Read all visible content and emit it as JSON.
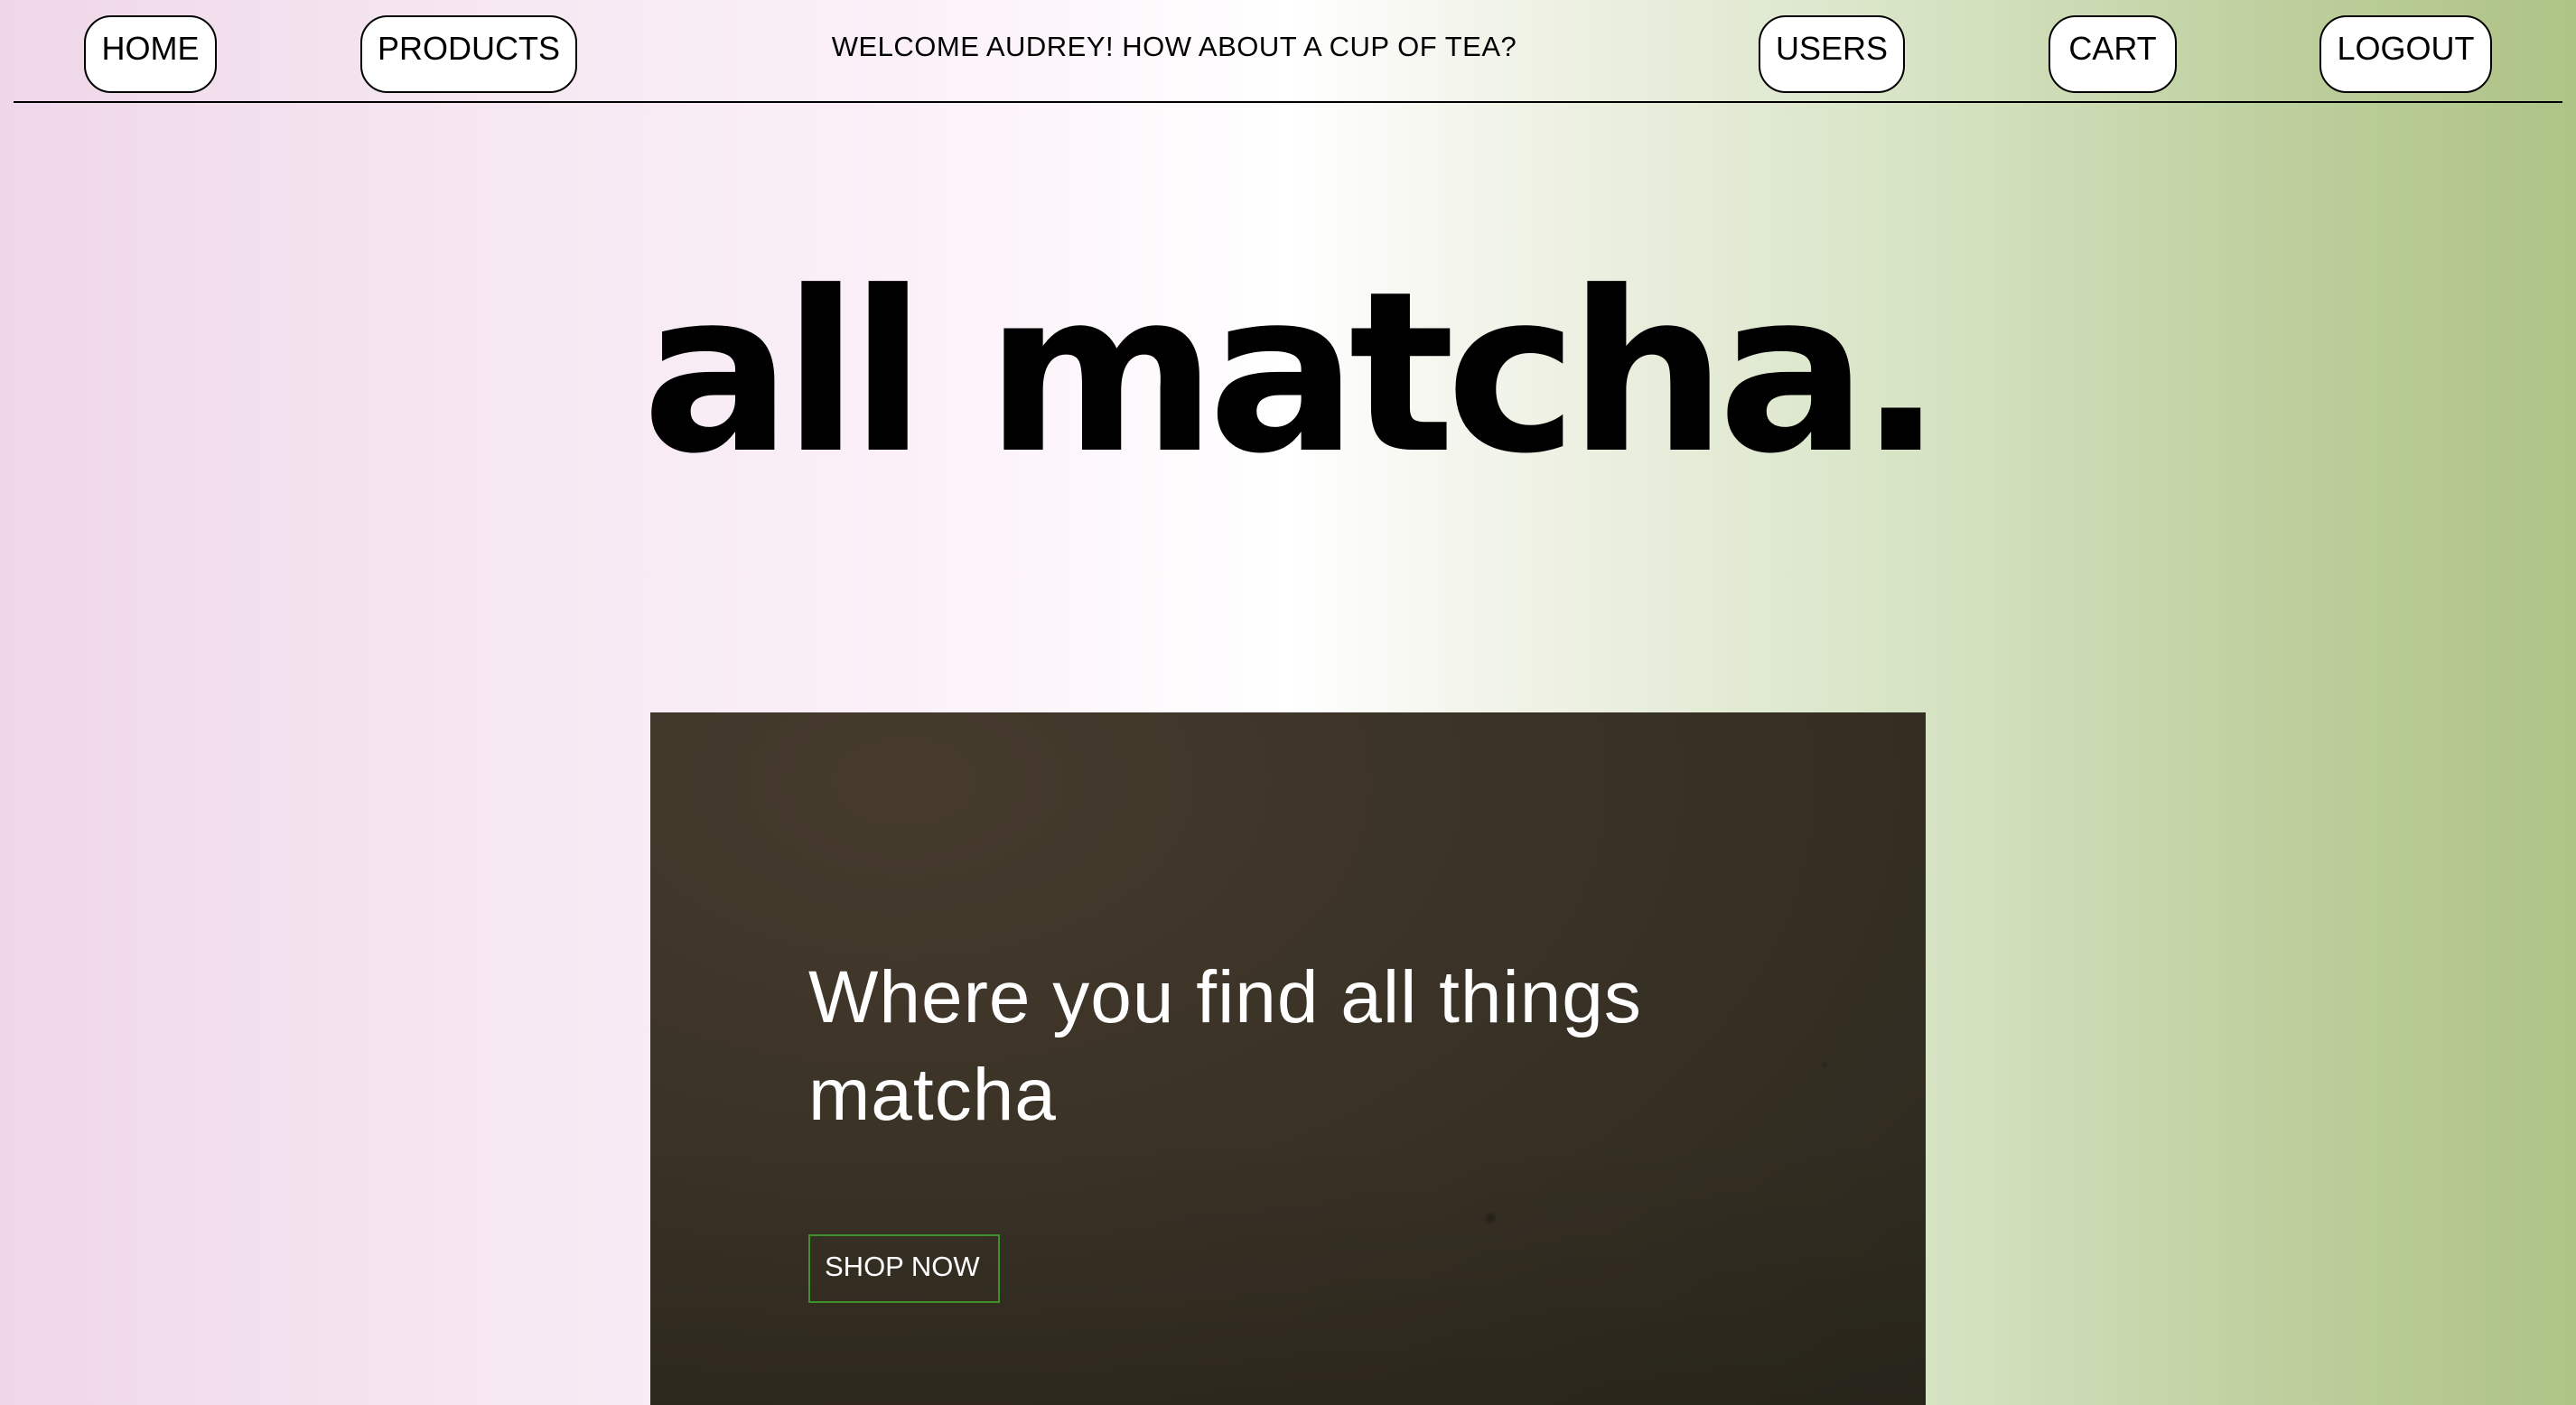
{
  "nav": {
    "home_label": "HOME",
    "products_label": "PRODUCTS",
    "welcome_text": "WELCOME AUDREY! HOW ABOUT A CUP OF TEA?",
    "users_label": "USERS",
    "cart_label": "CART",
    "logout_label": "LOGOUT"
  },
  "brand": {
    "title": "all matcha."
  },
  "hero": {
    "tagline": "Where you find all things matcha",
    "cta_label": "SHOP NOW"
  },
  "colors": {
    "gradient_left": "#efd7e9",
    "gradient_right": "#aec386",
    "hero_background": "#3a3226",
    "cta_border": "#3f8f2a"
  }
}
